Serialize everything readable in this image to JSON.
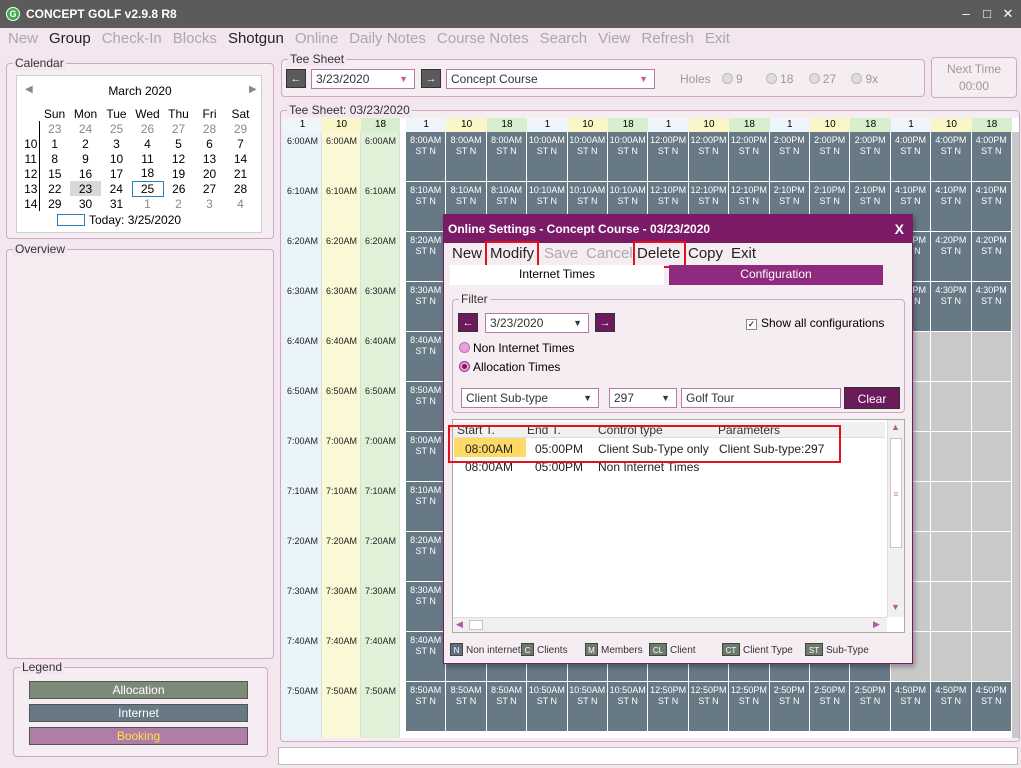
{
  "window": {
    "title": "CONCEPT GOLF v2.9.8 R8"
  },
  "menu": [
    "New",
    "Group",
    "Check-In",
    "Blocks",
    "Shotgun",
    "Online",
    "Daily Notes",
    "Course Notes",
    "Search",
    "View",
    "Refresh",
    "Exit"
  ],
  "calendar": {
    "label": "Calendar",
    "month": "March 2020",
    "weekdays": [
      "Sun",
      "Mon",
      "Tue",
      "Wed",
      "Thu",
      "Fri",
      "Sat"
    ],
    "weeks": [
      {
        "wk": "",
        "days": [
          "23",
          "24",
          "25",
          "26",
          "27",
          "28",
          "29"
        ]
      },
      {
        "wk": "10",
        "days": [
          "1",
          "2",
          "3",
          "4",
          "5",
          "6",
          "7"
        ]
      },
      {
        "wk": "11",
        "days": [
          "8",
          "9",
          "10",
          "11",
          "12",
          "13",
          "14"
        ]
      },
      {
        "wk": "12",
        "days": [
          "15",
          "16",
          "17",
          "18",
          "19",
          "20",
          "21"
        ]
      },
      {
        "wk": "13",
        "days": [
          "22",
          "23",
          "24",
          "25",
          "26",
          "27",
          "28"
        ]
      },
      {
        "wk": "14",
        "days": [
          "29",
          "30",
          "31",
          "1",
          "2",
          "3",
          "4"
        ]
      }
    ],
    "today": "Today: 3/25/2020"
  },
  "overview": {
    "label": "Overview"
  },
  "legend": {
    "label": "Legend",
    "items": [
      {
        "label": "Allocation",
        "color": "#7e8a78",
        "text": "#ffffff"
      },
      {
        "label": "Internet",
        "color": "#667985",
        "text": "#ffffff"
      },
      {
        "label": "Booking",
        "color": "#b07ca8",
        "text": "#ffe23a"
      }
    ]
  },
  "teesheet_top": {
    "label": "Tee Sheet",
    "date": "3/23/2020",
    "course": "Concept Course",
    "holes_label": "Holes",
    "holes": [
      "9",
      "18",
      "27",
      "9x"
    ]
  },
  "next_time": {
    "label": "Next Time",
    "value": "00:00"
  },
  "teesheet": {
    "title": "Tee Sheet: 03/23/2020",
    "hole_headers": [
      "1",
      "10",
      "18"
    ],
    "times": [
      "6:00AM",
      "6:10AM",
      "6:20AM",
      "6:30AM",
      "6:40AM",
      "6:50AM",
      "7:00AM",
      "7:10AM",
      "7:20AM",
      "7:30AM",
      "7:40AM",
      "7:50AM"
    ],
    "slot_hours": [
      "8",
      "10",
      "12",
      "2",
      "4"
    ],
    "slot_suffix": [
      "AM",
      "AM",
      "PM",
      "PM",
      "PM"
    ],
    "slot_code": "ST N"
  },
  "dialog": {
    "title": "Online Settings - Concept Course - 03/23/2020",
    "close": "X",
    "menu": [
      "New",
      "Modify",
      "Save",
      "Cancel",
      "Delete",
      "Copy",
      "Exit"
    ],
    "tabs": [
      "Internet Times",
      "Configuration"
    ],
    "filter": {
      "label": "Filter",
      "date": "3/23/2020",
      "show_all": "Show all configurations",
      "radio_non_internet": "Non Internet Times",
      "radio_allocation": "Allocation Times",
      "subtype": "Client Sub-type",
      "subtype_code": "297",
      "subtype_name": "Golf Tour",
      "clear": "Clear"
    },
    "columns": [
      "Start T.",
      "End T.",
      "Control type",
      "Parameters"
    ],
    "rows": [
      {
        "start": "08:00AM",
        "end": "05:00PM",
        "control": "Client Sub-Type only",
        "params": "Client Sub-type:297"
      },
      {
        "start": "08:00AM",
        "end": "05:00PM",
        "control": "Non Internet Times",
        "params": ""
      }
    ],
    "legend": [
      {
        "key": "N",
        "label": "Non internet"
      },
      {
        "key": "C",
        "label": "Clients"
      },
      {
        "key": "M",
        "label": "Members"
      },
      {
        "key": "CL",
        "label": "Client"
      },
      {
        "key": "CT",
        "label": "Client Type"
      },
      {
        "key": "ST",
        "label": "Sub-Type"
      }
    ]
  }
}
